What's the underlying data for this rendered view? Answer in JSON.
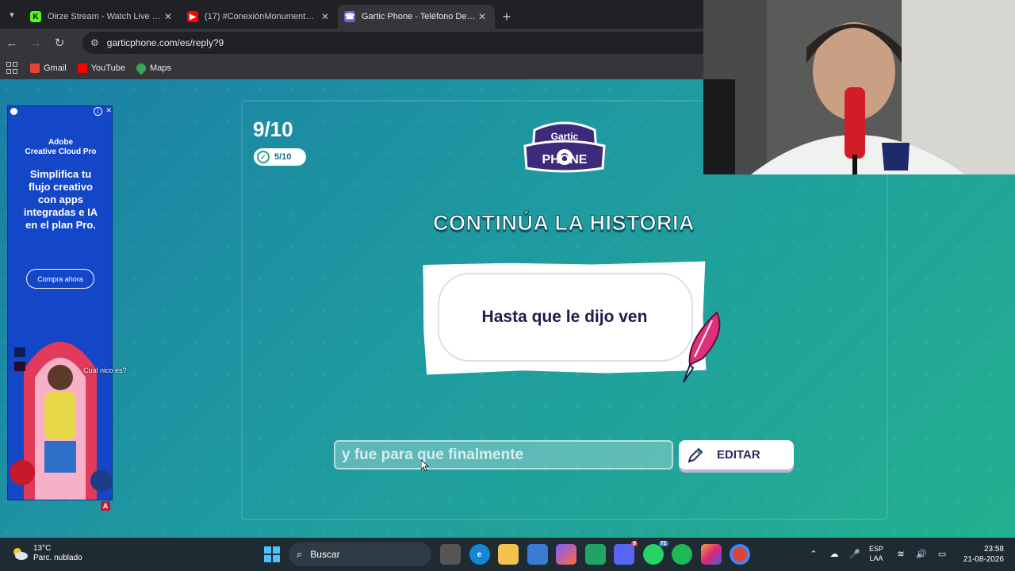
{
  "browser": {
    "tabs": [
      {
        "title": "Oirze Stream - Watch Live on Ki",
        "favicon": "kick-icon",
        "color": "#53fc18",
        "active": false
      },
      {
        "title": "(17) #ConexiónMonumental | C",
        "favicon": "youtube-icon",
        "color": "#ff0000",
        "active": false
      },
      {
        "title": "Gartic Phone - Teléfono Descon",
        "favicon": "gartic-icon",
        "color": "#7b5cd6",
        "active": true
      }
    ],
    "url": "garticphone.com/es/reply?9",
    "bookmarks": [
      {
        "label": "Gmail",
        "color": "#ea4335"
      },
      {
        "label": "YouTube",
        "color": "#ff0000"
      },
      {
        "label": "Maps",
        "color": "#34a853"
      }
    ]
  },
  "game": {
    "round": "9/10",
    "progress": "5/10",
    "logo_top": "Gartic",
    "logo_bottom": "PHONE",
    "heading": "CONTINÚA LA HISTORIA",
    "prompt": "Hasta que le dijo ven",
    "answer_value": "y fue para que finalmente",
    "edit_label": "EDITAR"
  },
  "ad": {
    "brand_line1": "Adobe",
    "brand_line2": "Creative Cloud Pro",
    "copy": "Simplifica tu flujo creativo con apps integradas e IA en el plan Pro.",
    "cta": "Compra ahora"
  },
  "overlay": {
    "chat": "Cual nico es?"
  },
  "taskbar": {
    "temp": "13°C",
    "weather": "Parc. nublado",
    "search": "Buscar",
    "lang1": "ESP",
    "lang2": "LAA",
    "time": "23:58",
    "date": "21-08-2026",
    "badges": {
      "discord": "9",
      "whatsapp": "72"
    }
  },
  "colors": {
    "accent_green": "#23a483",
    "page_blue": "#1a7fa6",
    "page_green": "#23b08f"
  }
}
